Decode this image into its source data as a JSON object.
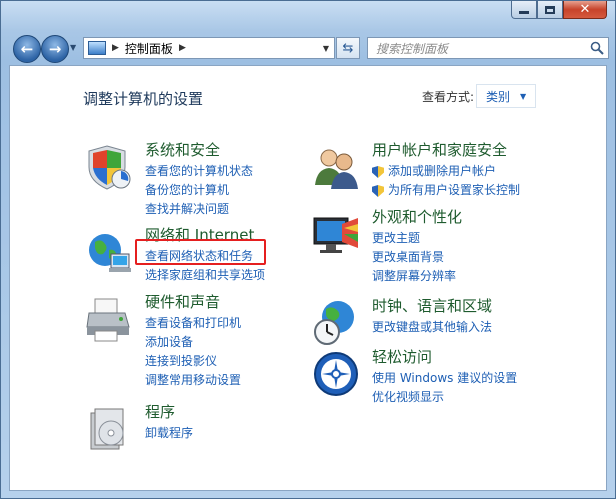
{
  "titlebar": {
    "min_label": "",
    "max_label": "",
    "close_label": "✕"
  },
  "toolbar": {
    "breadcrumb": "控制面板",
    "search_placeholder": "搜索控制面板"
  },
  "main": {
    "page_title": "调整计算机的设置",
    "view_by_label": "查看方式:",
    "view_by_value": "类别"
  },
  "categories": {
    "system": {
      "title": "系统和安全",
      "links": [
        "查看您的计算机状态",
        "备份您的计算机",
        "查找并解决问题"
      ]
    },
    "network": {
      "title": "网络和 Internet",
      "links": [
        "查看网络状态和任务",
        "选择家庭组和共享选项"
      ]
    },
    "hardware": {
      "title": "硬件和声音",
      "links": [
        "查看设备和打印机",
        "添加设备",
        "连接到投影仪",
        "调整常用移动设置"
      ]
    },
    "programs": {
      "title": "程序",
      "links": [
        "卸载程序"
      ]
    },
    "users": {
      "title": "用户帐户和家庭安全",
      "links": [
        "添加或删除用户帐户",
        "为所有用户设置家长控制"
      ]
    },
    "appearance": {
      "title": "外观和个性化",
      "links": [
        "更改主题",
        "更改桌面背景",
        "调整屏幕分辨率"
      ]
    },
    "clock": {
      "title": "时钟、语言和区域",
      "links": [
        "更改键盘或其他输入法"
      ]
    },
    "ease": {
      "title": "轻松访问",
      "links": [
        "使用 Windows 建议的设置",
        "优化视频显示"
      ]
    }
  },
  "colors": {
    "highlight_box": "#e51f1f",
    "link": "#1e5fb4",
    "category_title": "#1e5b2e"
  }
}
